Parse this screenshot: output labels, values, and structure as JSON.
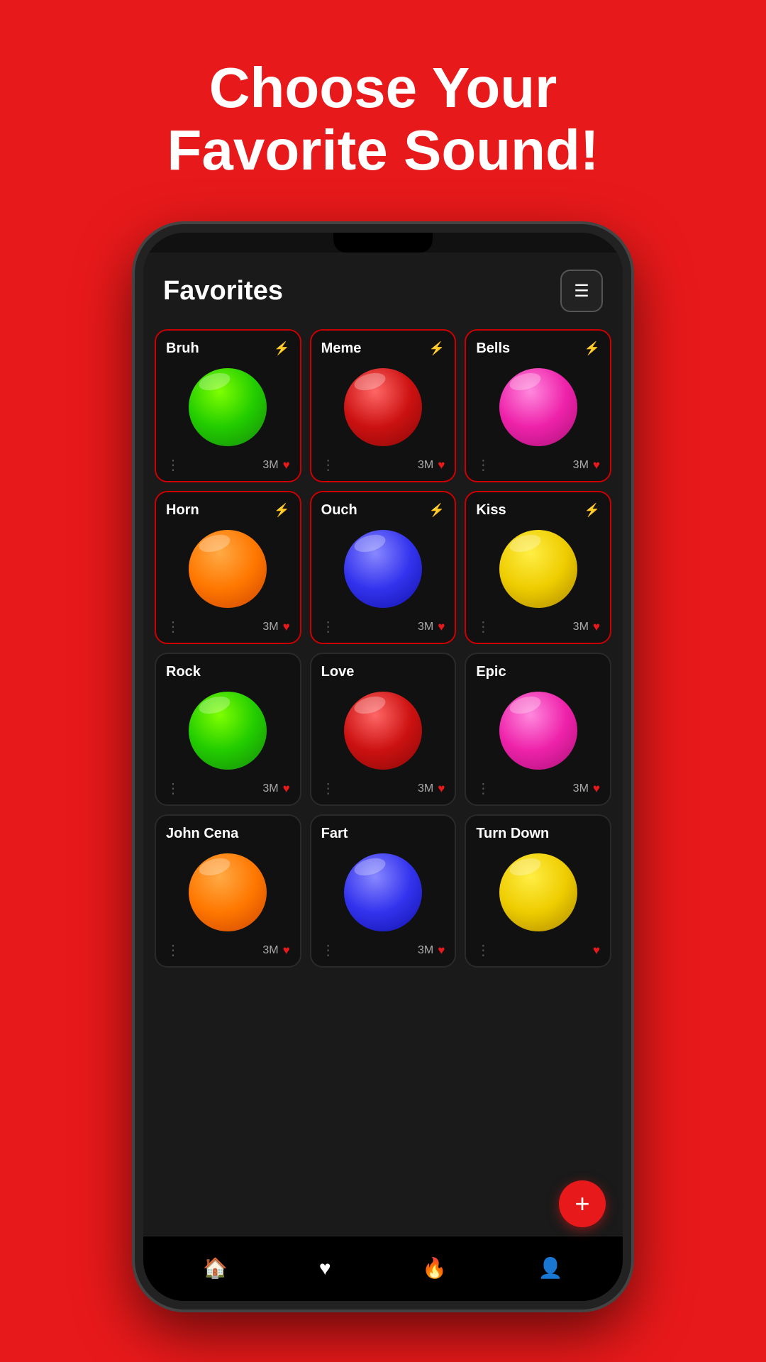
{
  "headline": {
    "line1": "Choose Your",
    "line2": "Favorite Sound!"
  },
  "app": {
    "title": "Favorites",
    "filter_label": "filter"
  },
  "sounds": [
    {
      "id": 1,
      "name": "Bruh",
      "color": "green",
      "count": "3M",
      "favorited": true
    },
    {
      "id": 2,
      "name": "Meme",
      "color": "red",
      "count": "3M",
      "favorited": true
    },
    {
      "id": 3,
      "name": "Bells",
      "color": "pink",
      "count": "3M",
      "favorited": true
    },
    {
      "id": 4,
      "name": "Horn",
      "color": "orange",
      "count": "3M",
      "favorited": true
    },
    {
      "id": 5,
      "name": "Ouch",
      "color": "blue",
      "count": "3M",
      "favorited": true
    },
    {
      "id": 6,
      "name": "Kiss",
      "color": "yellow",
      "count": "3M",
      "favorited": true
    },
    {
      "id": 7,
      "name": "Rock",
      "color": "green",
      "count": "3M",
      "favorited": false
    },
    {
      "id": 8,
      "name": "Love",
      "color": "red",
      "count": "3M",
      "favorited": false
    },
    {
      "id": 9,
      "name": "Epic",
      "color": "pink",
      "count": "3M",
      "favorited": false
    },
    {
      "id": 10,
      "name": "John Cena",
      "color": "orange",
      "count": "3M",
      "favorited": false
    },
    {
      "id": 11,
      "name": "Fart",
      "color": "blue",
      "count": "3M",
      "favorited": false
    },
    {
      "id": 12,
      "name": "Turn Down",
      "color": "yellow",
      "count": "",
      "favorited": false
    }
  ],
  "nav": {
    "items": [
      {
        "id": "home",
        "icon": "🏠",
        "active": false
      },
      {
        "id": "favorites",
        "icon": "♥",
        "active": true
      },
      {
        "id": "trending",
        "icon": "🔥",
        "active": false
      },
      {
        "id": "profile",
        "icon": "👤",
        "active": false
      }
    ]
  },
  "fab": {
    "label": "+"
  }
}
